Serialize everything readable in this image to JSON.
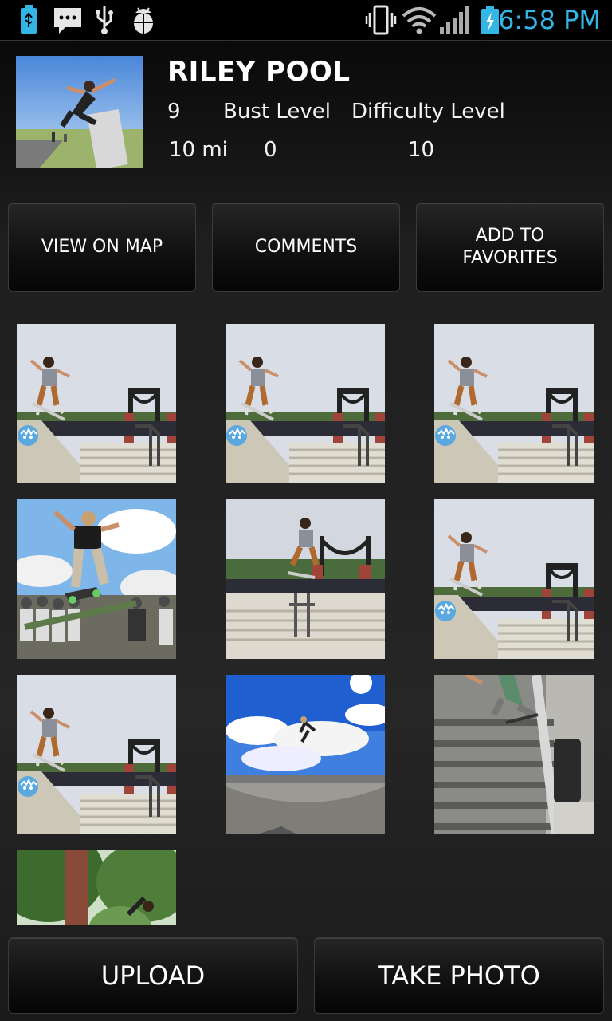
{
  "status_bar": {
    "time": "6:58 PM",
    "left_icons": [
      "usb-battery-icon",
      "sms-icon",
      "usb-icon",
      "debug-bug-icon"
    ],
    "right_icons": [
      "vibrate-icon",
      "wifi-icon",
      "signal-icon",
      "battery-charging-icon"
    ],
    "time_color": "#33b5e5"
  },
  "spot": {
    "name": "RILEY POOL",
    "count": "9",
    "bust_label": "Bust Level",
    "difficulty_label": "Difficulty Level",
    "distance": "10 mi",
    "bust_value": "0",
    "difficulty_value": "10"
  },
  "actions": {
    "view_on_map": "VIEW ON MAP",
    "comments": "COMMENTS",
    "add_to_favorites": "ADD TO FAVORITES"
  },
  "gallery": {
    "photos": [
      {
        "scene": "rail-stairs-logo"
      },
      {
        "scene": "rail-stairs-logo"
      },
      {
        "scene": "rail-stairs-logo"
      },
      {
        "scene": "crowd-grind"
      },
      {
        "scene": "stairs-jump"
      },
      {
        "scene": "rail-stairs-logo"
      },
      {
        "scene": "rail-stairs-logo"
      },
      {
        "scene": "bowl-sky"
      },
      {
        "scene": "handrail"
      },
      {
        "scene": "trees"
      }
    ]
  },
  "bottom": {
    "upload": "UPLOAD",
    "take_photo": "TAKE PHOTO"
  }
}
